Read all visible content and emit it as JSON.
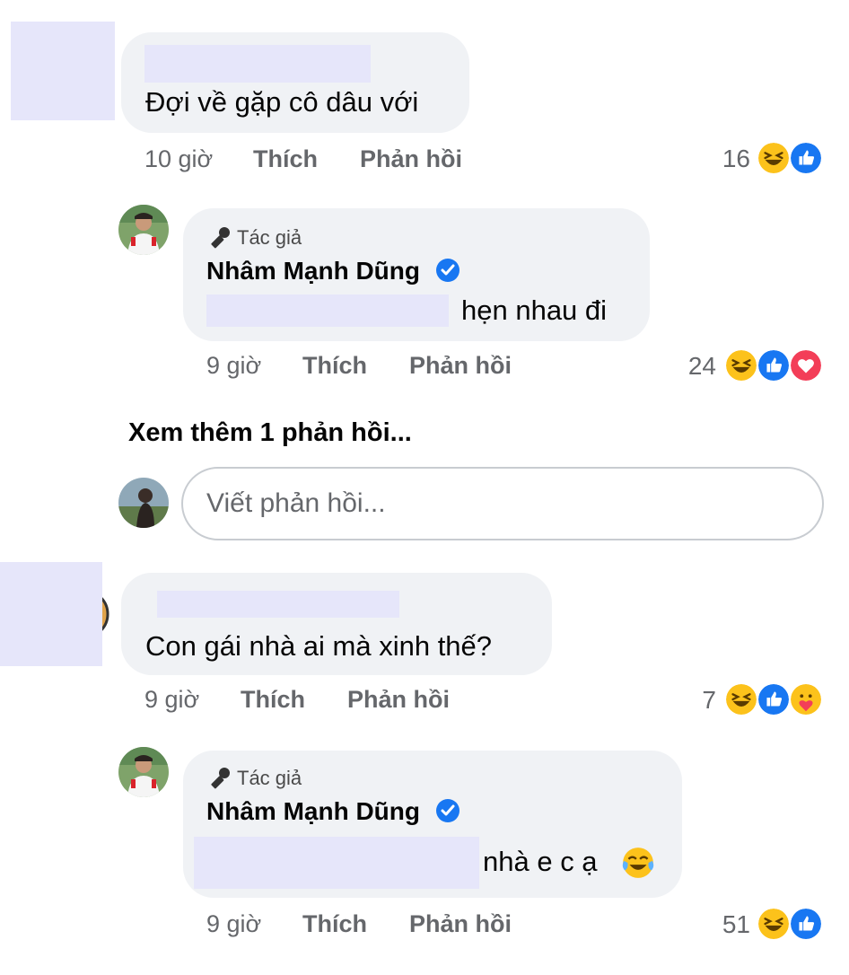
{
  "comments": [
    {
      "text": "Đợi về gặp cô dâu với",
      "time": "10 giờ",
      "like_label": "Thích",
      "reply_label": "Phản hồi",
      "reaction_count": "16",
      "reactions": [
        "haha",
        "like"
      ]
    },
    {
      "author_badge": "Tác giả",
      "name": "Nhâm Mạnh Dũng",
      "text": "hẹn nhau đi",
      "time": "9 giờ",
      "like_label": "Thích",
      "reply_label": "Phản hồi",
      "reaction_count": "24",
      "reactions": [
        "haha",
        "like",
        "love"
      ]
    },
    {
      "text": "Con gái nhà ai mà xinh thế?",
      "time": "9 giờ",
      "like_label": "Thích",
      "reply_label": "Phản hồi",
      "reaction_count": "7",
      "reactions": [
        "haha",
        "like",
        "care"
      ]
    },
    {
      "author_badge": "Tác giả",
      "name": "Nhâm Mạnh Dũng",
      "text": "nhà e c ạ",
      "time": "9 giờ",
      "like_label": "Thích",
      "reply_label": "Phản hồi",
      "reaction_count": "51",
      "reactions": [
        "haha",
        "like"
      ]
    }
  ],
  "see_more_replies": "Xem thêm 1 phản hồi...",
  "reply_input": {
    "placeholder": "Viết phản hồi..."
  },
  "colors": {
    "bubble": "#f0f2f5",
    "meta_text": "#65676b",
    "verified": "#1877f2",
    "redaction": "#e6e6fa"
  }
}
